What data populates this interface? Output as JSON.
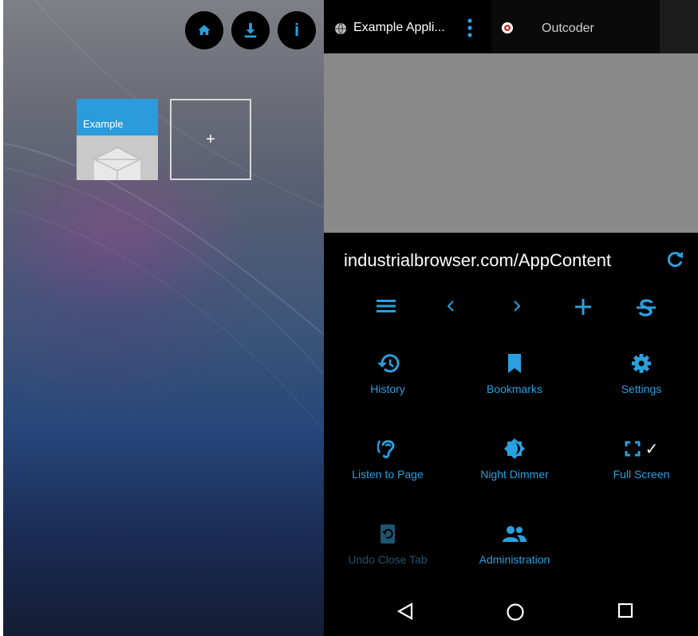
{
  "colors": {
    "accent": "#2aa0df",
    "accent_disabled": "#1d5571",
    "tile_header": "#2b9bdb",
    "menu_bg": "#000000",
    "content_bg": "#898989"
  },
  "home": {
    "buttons": [
      {
        "name": "home-icon"
      },
      {
        "name": "download-icon"
      },
      {
        "name": "info-icon",
        "glyph": "i"
      }
    ],
    "tiles": [
      {
        "label": "Example",
        "icon": "box-icon"
      },
      {
        "label": "+",
        "icon": "plus-icon"
      }
    ]
  },
  "tabs": [
    {
      "title": "Example Appli...",
      "icon": "globe-icon",
      "active": true
    },
    {
      "title": "Outcoder",
      "icon": "outcoder-icon",
      "active": false
    }
  ],
  "address": {
    "url": "industrialbrowser.com/AppContent",
    "refresh_icon": "refresh-icon"
  },
  "nav": [
    "menu-icon",
    "back-icon",
    "forward-icon",
    "new-tab-icon",
    "strikethrough-icon"
  ],
  "menu_items": [
    {
      "label": "History",
      "icon": "history-icon",
      "enabled": true
    },
    {
      "label": "Bookmarks",
      "icon": "bookmark-icon",
      "enabled": true
    },
    {
      "label": "Settings",
      "icon": "gear-icon",
      "enabled": true
    },
    {
      "label": "Listen to Page",
      "icon": "hearing-icon",
      "enabled": true
    },
    {
      "label": "Night Dimmer",
      "icon": "brightness-icon",
      "enabled": true
    },
    {
      "label": "Full Screen",
      "icon": "fullscreen-icon",
      "enabled": true,
      "checked": true,
      "check_glyph": "✓"
    },
    {
      "label": "Undo Close Tab",
      "icon": "undo-close-tab-icon",
      "enabled": false
    },
    {
      "label": "Administration",
      "icon": "admin-icon",
      "enabled": true
    }
  ],
  "system_nav": [
    "back-triangle-icon",
    "home-circle-icon",
    "recents-square-icon"
  ]
}
